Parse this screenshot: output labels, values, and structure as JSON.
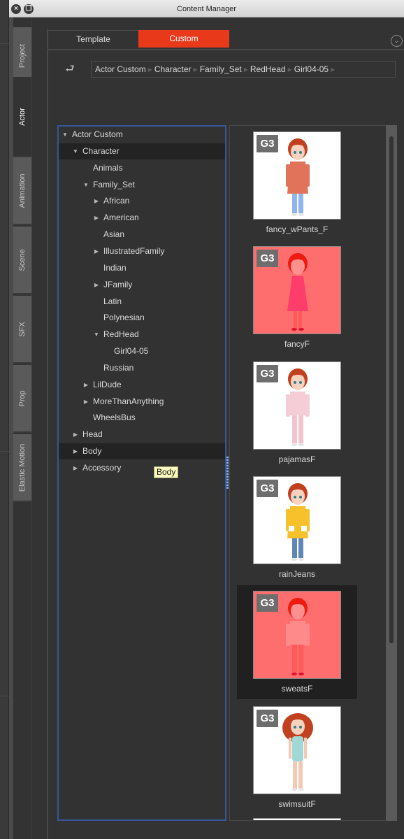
{
  "window": {
    "title": "Content Manager",
    "close_icon": "close-icon",
    "restore_icon": "restore-icon"
  },
  "side_tabs": [
    {
      "label": "Project",
      "active": false
    },
    {
      "label": "Actor",
      "active": true
    },
    {
      "label": "Animation",
      "active": false
    },
    {
      "label": "Scene",
      "active": false
    },
    {
      "label": "SFX",
      "active": false
    },
    {
      "label": "Prop",
      "active": false
    },
    {
      "label": "Elastic Motion",
      "active": false
    }
  ],
  "top_tabs": [
    {
      "label": "Template",
      "active": false
    },
    {
      "label": "Custom",
      "active": true
    }
  ],
  "accent_color": "#e8391b",
  "collapse_icon": "chevron-down-circle-icon",
  "back_icon": "return-arrow-icon",
  "breadcrumb": [
    "Actor Custom",
    "Character",
    "Family_Set",
    "RedHead",
    "Girl04-05"
  ],
  "tree": [
    {
      "label": "Actor Custom",
      "level": 0,
      "state": "expanded"
    },
    {
      "label": "Character",
      "level": 1,
      "state": "expanded",
      "highlight": true
    },
    {
      "label": "Animals",
      "level": 2,
      "state": "leaf"
    },
    {
      "label": "Family_Set",
      "level": 2,
      "state": "expanded"
    },
    {
      "label": "African",
      "level": 3,
      "state": "collapsed"
    },
    {
      "label": "American",
      "level": 3,
      "state": "collapsed"
    },
    {
      "label": "Asian",
      "level": 3,
      "state": "leaf"
    },
    {
      "label": "IllustratedFamily",
      "level": 3,
      "state": "collapsed"
    },
    {
      "label": "Indian",
      "level": 3,
      "state": "leaf"
    },
    {
      "label": "JFamily",
      "level": 3,
      "state": "collapsed"
    },
    {
      "label": "Latin",
      "level": 3,
      "state": "leaf"
    },
    {
      "label": "Polynesian",
      "level": 3,
      "state": "leaf"
    },
    {
      "label": "RedHead",
      "level": 3,
      "state": "expanded"
    },
    {
      "label": "Girl04-05",
      "level": 4,
      "state": "leaf"
    },
    {
      "label": "Russian",
      "level": 3,
      "state": "leaf"
    },
    {
      "label": "LilDude",
      "level": 2,
      "state": "collapsed"
    },
    {
      "label": "MoreThanAnything",
      "level": 2,
      "state": "collapsed"
    },
    {
      "label": "WheelsBus",
      "level": 2,
      "state": "leaf"
    },
    {
      "label": "Head",
      "level": 1,
      "state": "collapsed"
    },
    {
      "label": "Body",
      "level": 1,
      "state": "collapsed",
      "highlight": true
    },
    {
      "label": "Accessory",
      "level": 1,
      "state": "collapsed"
    }
  ],
  "tooltip": "Body",
  "items": [
    {
      "name": "fancy_wPants_F",
      "badge": "G3",
      "tinted": false,
      "selected": false,
      "outfit": "#e0735a",
      "legs": "#8fb4f0",
      "hair": "#c1401f",
      "style": "hoodie"
    },
    {
      "name": "fancyF",
      "badge": "G3",
      "tinted": true,
      "selected": false,
      "outfit": "#ff3d6a",
      "legs": "#ff5a5a",
      "hair": "#ee1c10",
      "style": "dress"
    },
    {
      "name": "pajamasF",
      "badge": "G3",
      "tinted": false,
      "selected": false,
      "outfit": "#f5cdd6",
      "legs": "#f3c4cf",
      "hair": "#c1401f",
      "style": "pajamas"
    },
    {
      "name": "rainJeans",
      "badge": "G3",
      "tinted": false,
      "selected": false,
      "outfit": "#f6c12a",
      "legs": "#5f86b5",
      "hair": "#c1401f",
      "style": "raincoat"
    },
    {
      "name": "sweatsF",
      "badge": "G3",
      "tinted": true,
      "selected": true,
      "outfit": "#ff8a8a",
      "legs": "#ff5a5a",
      "hair": "#ee1c10",
      "style": "sweats"
    },
    {
      "name": "swimsuitF",
      "badge": "G3",
      "tinted": false,
      "selected": false,
      "outfit": "#9fd8d4",
      "legs": "#f3c9b3",
      "hair": "#c1401f",
      "style": "swimsuit"
    }
  ]
}
